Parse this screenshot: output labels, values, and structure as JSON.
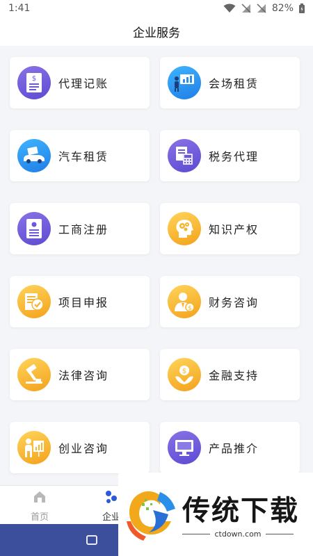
{
  "status_bar": {
    "time": "1:41",
    "battery": "82%"
  },
  "page": {
    "title": "企业服务"
  },
  "services": [
    {
      "label": "代理记账",
      "icon": "ledger-icon",
      "color": "purple"
    },
    {
      "label": "会场租赁",
      "icon": "presentation-icon",
      "color": "blue"
    },
    {
      "label": "汽车租赁",
      "icon": "car-icon",
      "color": "blue"
    },
    {
      "label": "税务代理",
      "icon": "tax-document-icon",
      "color": "purple"
    },
    {
      "label": "工商注册",
      "icon": "certificate-icon",
      "color": "purple"
    },
    {
      "label": "知识产权",
      "icon": "brain-gears-icon",
      "color": "orange"
    },
    {
      "label": "项目申报",
      "icon": "approved-document-icon",
      "color": "orange"
    },
    {
      "label": "财务咨询",
      "icon": "finance-advisor-icon",
      "color": "orange"
    },
    {
      "label": "法律咨询",
      "icon": "gavel-icon",
      "color": "orange"
    },
    {
      "label": "金融支持",
      "icon": "money-hand-icon",
      "color": "orange"
    },
    {
      "label": "创业咨询",
      "icon": "business-chart-icon",
      "color": "orange"
    },
    {
      "label": "产品推介",
      "icon": "monitor-icon",
      "color": "purple"
    }
  ],
  "bottom_nav": [
    {
      "label": "首页",
      "icon": "home-icon",
      "active": false
    },
    {
      "label": "企业",
      "icon": "enterprise-icon",
      "active": true
    }
  ],
  "watermark": {
    "text": "传统下载",
    "url": "ctdown.com"
  },
  "colors": {
    "purple": "#6b57dc",
    "blue": "#2a90f0",
    "orange": "#f6b52e",
    "nav_bar": "#3c4f9c"
  }
}
